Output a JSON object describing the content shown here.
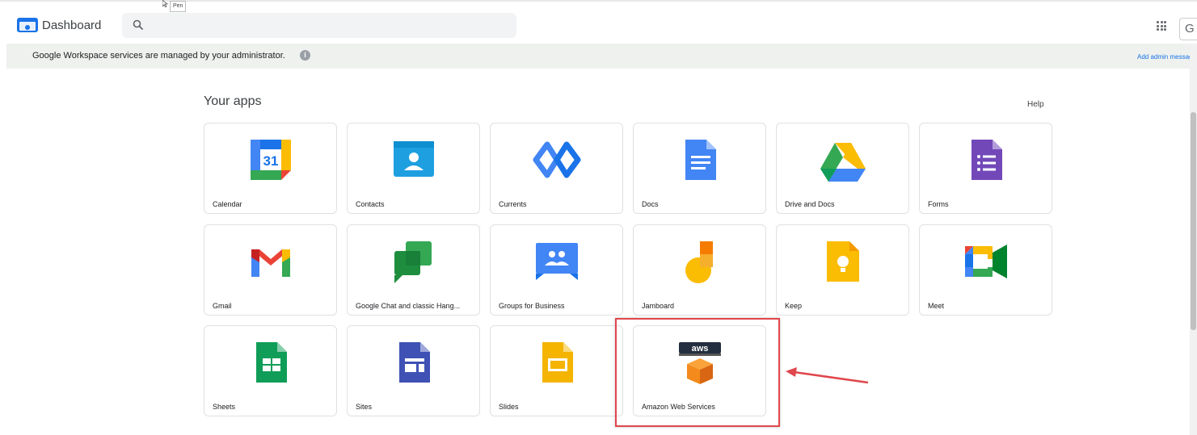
{
  "header": {
    "title": "Dashboard",
    "search_placeholder": "",
    "cursor_tooltip": "Pen",
    "account_initial": "G"
  },
  "banner": {
    "message": "Google Workspace services are managed by your administrator.",
    "info_icon": "info-icon",
    "admin_link": "Add admin messag"
  },
  "apps": {
    "heading": "Your apps",
    "help": "Help",
    "items": [
      {
        "label": "Calendar",
        "icon": "calendar-icon"
      },
      {
        "label": "Contacts",
        "icon": "contacts-icon"
      },
      {
        "label": "Currents",
        "icon": "currents-icon"
      },
      {
        "label": "Docs",
        "icon": "docs-icon"
      },
      {
        "label": "Drive and Docs",
        "icon": "drive-icon"
      },
      {
        "label": "Forms",
        "icon": "forms-icon"
      },
      {
        "label": "Gmail",
        "icon": "gmail-icon"
      },
      {
        "label": "Google Chat and classic Hang...",
        "icon": "chat-icon"
      },
      {
        "label": "Groups for Business",
        "icon": "groups-icon"
      },
      {
        "label": "Jamboard",
        "icon": "jamboard-icon"
      },
      {
        "label": "Keep",
        "icon": "keep-icon"
      },
      {
        "label": "Meet",
        "icon": "meet-icon"
      },
      {
        "label": "Sheets",
        "icon": "sheets-icon"
      },
      {
        "label": "Sites",
        "icon": "sites-icon"
      },
      {
        "label": "Slides",
        "icon": "slides-icon"
      },
      {
        "label": "Amazon Web Services",
        "icon": "aws-icon"
      }
    ]
  },
  "annotation": {
    "highlight_color": "#e0474c"
  }
}
